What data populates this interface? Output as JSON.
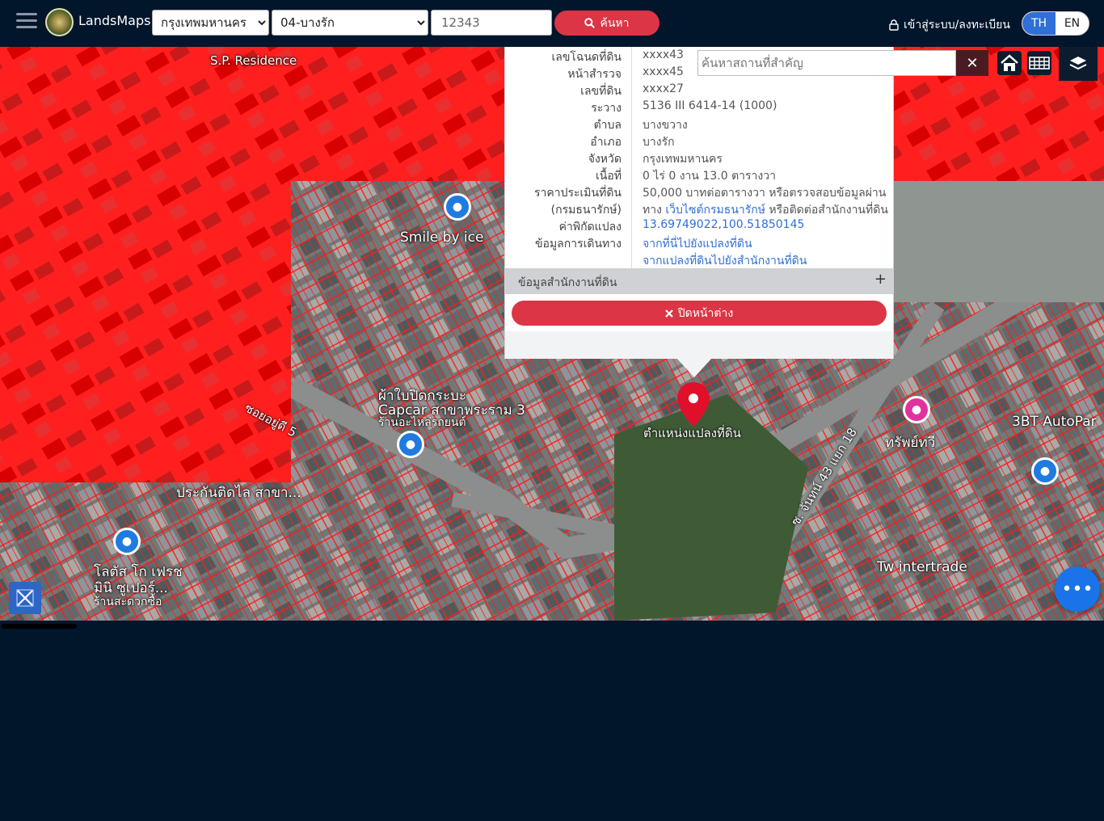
{
  "header": {
    "brand": "LandsMaps",
    "province_select": {
      "selected": "กรุงเทพมหานคร"
    },
    "district_select": {
      "selected": "04-บางรัก"
    },
    "parcel_input": {
      "value": "12343"
    },
    "search_label": "ค้นหา",
    "login_label": "เข้าสู่ระบบ/ลงทะเบียน",
    "lang": {
      "th": "TH",
      "en": "EN",
      "active": "TH"
    }
  },
  "map": {
    "labels": [
      {
        "text": "Smile by ice"
      },
      {
        "text": "ตำแหน่งแปลงที่ดิน"
      },
      {
        "text": "Tw intertrade"
      },
      {
        "text": "ทรัพย์ทวี"
      },
      {
        "text": "3BT AutoPar"
      },
      {
        "text": "ประกันติดไล สาขา..."
      },
      {
        "text": "โลตัส โก เฟรช"
      },
      {
        "text": "มินิ ซูเปอร์..."
      },
      {
        "text": "ร้านสะดวกซื้อ"
      },
      {
        "text": "ผ้าใบปิดกระบะ"
      },
      {
        "text": "Capcar สาขาพระราม 3"
      },
      {
        "text": "ร้านอะไหล่รถยนต์"
      },
      {
        "text": "ซอยอยู่ดี 5"
      },
      {
        "text": "ซ. จันทน์ 43 แยก 18"
      },
      {
        "text": "S.P. Residence"
      }
    ]
  },
  "popup": {
    "rows": [
      {
        "key": "เลขโฉนดที่ดิน",
        "value": "xxxx43"
      },
      {
        "key": "หน้าสำรวจ",
        "value": "xxxx45"
      },
      {
        "key": "เลขที่ดิน",
        "value": "xxxx27"
      },
      {
        "key": "ระวาง",
        "value": "5136 III 6414-14 (1000)"
      },
      {
        "key": "ตำบล",
        "value": "บางขวาง"
      },
      {
        "key": "อำเภอ",
        "value": "บางรัก"
      },
      {
        "key": "จังหวัด",
        "value": "กรุงเทพมหานคร"
      },
      {
        "key": "เนื้อที่",
        "value": "0 ไร่ 0 งาน 13.0 ตารางวา"
      },
      {
        "key": "ราคาประเมินที่ดิน",
        "value": "50,000 บาทต่อตารางวา หรือตรวจสอบข้อมูลผ่าน"
      },
      {
        "key": "(กรมธนารักษ์)",
        "value_prefix": "ทาง ",
        "value_link": "เว็บไซต์กรมธนารักษ์",
        "value_suffix": " หรือติดต่อสำนักงานที่ดิน"
      },
      {
        "key": "ค่าพิกัดแปลง",
        "value_link": "13.69749022,100.51850145"
      },
      {
        "key": "ข้อมูลการเดินทาง",
        "value_link": "จากที่นี่ไปยังแปลงที่ดิน"
      },
      {
        "key": "",
        "value_link": "จากแปลงที่ดินไปยังสำนักงานที่ดิน"
      }
    ],
    "section_label": "ข้อมูลสำนักงานที่ดิน",
    "section_toggle": "+",
    "close_label": "ปิดหน้าต่าง"
  },
  "tools": {
    "place_search_placeholder": "ค้นหาสถานที่สำคัญ",
    "clear_symbol": "✕",
    "fab_symbol": "•••"
  },
  "colors": {
    "accent": "#dc3545",
    "header_bg": "#01152b",
    "link": "#2f6fd6",
    "parcel_line": "#ff1a1a"
  }
}
